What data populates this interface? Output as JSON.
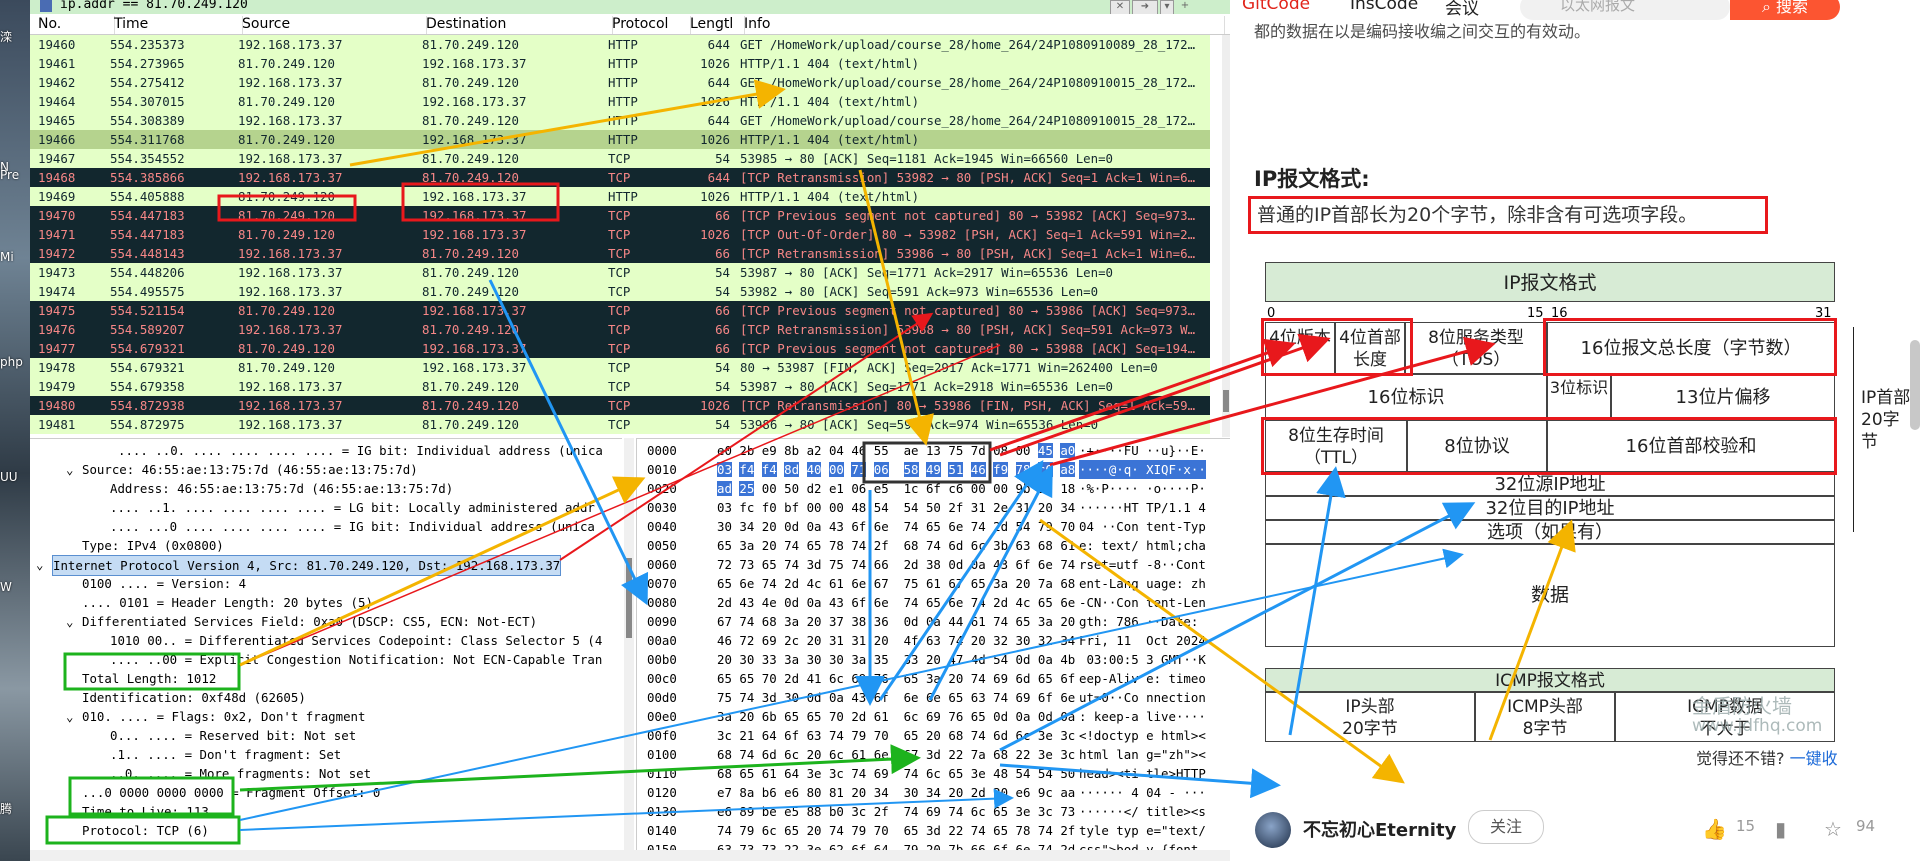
{
  "desktop": {
    "labels": [
      "滦",
      "N",
      "Pre",
      "Mi",
      "php",
      "UU",
      "W",
      "腾"
    ]
  },
  "filter": {
    "value": "ip.addr == 81.70.249.120"
  },
  "columns": [
    "No.",
    "Time",
    "Source",
    "Destination",
    "Protocol",
    "Lengtl",
    "Info"
  ],
  "packets": [
    {
      "no": "19460",
      "time": "554.235373",
      "src": "192.168.173.37",
      "dst": "81.70.249.120",
      "proto": "HTTP",
      "len": "644",
      "info": "GET /HomeWork/upload/course_28/home_264/24P1080910089_28_172…",
      "style": "g"
    },
    {
      "no": "19461",
      "time": "554.273965",
      "src": "81.70.249.120",
      "dst": "192.168.173.37",
      "proto": "HTTP",
      "len": "1026",
      "info": "HTTP/1.1 404   (text/html)",
      "style": "g"
    },
    {
      "no": "19462",
      "time": "554.275412",
      "src": "192.168.173.37",
      "dst": "81.70.249.120",
      "proto": "HTTP",
      "len": "644",
      "info": "GET /HomeWork/upload/course_28/home_264/24P1080910015_28_172…",
      "style": "g"
    },
    {
      "no": "19464",
      "time": "554.307015",
      "src": "81.70.249.120",
      "dst": "192.168.173.37",
      "proto": "HTTP",
      "len": "1026",
      "info": "HTTP/1.1 404   (text/html)",
      "style": "g"
    },
    {
      "no": "19465",
      "time": "554.308389",
      "src": "192.168.173.37",
      "dst": "81.70.249.120",
      "proto": "HTTP",
      "len": "644",
      "info": "GET /HomeWork/upload/course_28/home_264/24P1080910015_28_172…",
      "style": "g"
    },
    {
      "no": "19466",
      "time": "554.311768",
      "src": "81.70.249.120",
      "dst": "192.168.173.37",
      "proto": "HTTP",
      "len": "1026",
      "info": "HTTP/1.1 404   (text/html)",
      "style": "s"
    },
    {
      "no": "19467",
      "time": "554.354552",
      "src": "192.168.173.37",
      "dst": "81.70.249.120",
      "proto": "TCP",
      "len": "54",
      "info": "53985 → 80 [ACK] Seq=1181 Ack=1945 Win=66560 Len=0",
      "style": "g"
    },
    {
      "no": "19468",
      "time": "554.385866",
      "src": "192.168.173.37",
      "dst": "81.70.249.120",
      "proto": "TCP",
      "len": "644",
      "info": "[TCP Retransmission] 53982 → 80 [PSH, ACK] Seq=1 Ack=1 Win=6…",
      "style": "d"
    },
    {
      "no": "19469",
      "time": "554.405888",
      "src": "81.70.249.120",
      "dst": "192.168.173.37",
      "proto": "HTTP",
      "len": "1026",
      "info": "HTTP/1.1 404   (text/html)",
      "style": "g"
    },
    {
      "no": "19470",
      "time": "554.447183",
      "src": "81.70.249.120",
      "dst": "192.168.173.37",
      "proto": "TCP",
      "len": "66",
      "info": "[TCP Previous segment not captured] 80 → 53982 [ACK] Seq=973…",
      "style": "d"
    },
    {
      "no": "19471",
      "time": "554.447183",
      "src": "81.70.249.120",
      "dst": "192.168.173.37",
      "proto": "TCP",
      "len": "1026",
      "info": "[TCP Out-Of-Order] 80 → 53982 [PSH, ACK] Seq=1 Ack=591 Win=2…",
      "style": "d"
    },
    {
      "no": "19472",
      "time": "554.448143",
      "src": "192.168.173.37",
      "dst": "81.70.249.120",
      "proto": "TCP",
      "len": "66",
      "info": "[TCP Retransmission] 53986 → 80 [PSH, ACK] Seq=1 Ack=1 Win=6…",
      "style": "d"
    },
    {
      "no": "19473",
      "time": "554.448206",
      "src": "192.168.173.37",
      "dst": "81.70.249.120",
      "proto": "TCP",
      "len": "54",
      "info": "53987 → 80 [ACK] Seq=1771 Ack=2917 Win=65536 Len=0",
      "style": "g"
    },
    {
      "no": "19474",
      "time": "554.495575",
      "src": "192.168.173.37",
      "dst": "81.70.249.120",
      "proto": "TCP",
      "len": "54",
      "info": "53982 → 80 [ACK] Seq=591 Ack=973 Win=65536 Len=0",
      "style": "g"
    },
    {
      "no": "19475",
      "time": "554.521154",
      "src": "81.70.249.120",
      "dst": "192.168.173.37",
      "proto": "TCP",
      "len": "66",
      "info": "[TCP Previous segment not captured] 80 → 53986 [ACK] Seq=973…",
      "style": "d"
    },
    {
      "no": "19476",
      "time": "554.589207",
      "src": "192.168.173.37",
      "dst": "81.70.249.120",
      "proto": "TCP",
      "len": "66",
      "info": "[TCP Retransmission] 53988 → 80 [PSH, ACK] Seq=591 Ack=973 W…",
      "style": "d"
    },
    {
      "no": "19477",
      "time": "554.679321",
      "src": "81.70.249.120",
      "dst": "192.168.173.37",
      "proto": "TCP",
      "len": "66",
      "info": "[TCP Previous segment not captured] 80 → 53988 [ACK] Seq=194…",
      "style": "d"
    },
    {
      "no": "19478",
      "time": "554.679321",
      "src": "81.70.249.120",
      "dst": "192.168.173.37",
      "proto": "TCP",
      "len": "54",
      "info": "80 → 53987 [FIN, ACK] Seq=2917 Ack=1771 Win=262400 Len=0",
      "style": "g"
    },
    {
      "no": "19479",
      "time": "554.679358",
      "src": "192.168.173.37",
      "dst": "81.70.249.120",
      "proto": "TCP",
      "len": "54",
      "info": "53987 → 80 [ACK] Seq=1771 Ack=2918 Win=65536 Len=0",
      "style": "g"
    },
    {
      "no": "19480",
      "time": "554.872938",
      "src": "192.168.173.37",
      "dst": "81.70.249.120",
      "proto": "TCP",
      "len": "1026",
      "info": "[TCP Retransmission] 80 → 53986 [FIN, PSH, ACK] Seq=1 Ack=59…",
      "style": "d"
    },
    {
      "no": "19481",
      "time": "554.872975",
      "src": "192.168.173.37",
      "dst": "81.70.249.120",
      "proto": "TCP",
      "len": "54",
      "info": "53986 → 80 [ACK] Seq=591 Ack=974 Win=65536 Len=0",
      "style": "g"
    }
  ],
  "details": [
    {
      "t": ".... ..0. .... .... .... .... = IG bit: Individual address (unica",
      "x": 88,
      "sel": false
    },
    {
      "t": "Source: 46:55:ae:13:75:7d (46:55:ae:13:75:7d)",
      "x": 52,
      "tog": "⌄",
      "sel": false
    },
    {
      "t": "Address: 46:55:ae:13:75:7d (46:55:ae:13:75:7d)",
      "x": 80,
      "sel": false
    },
    {
      "t": ".... ..1. .... .... .... .... = LG bit: Locally administered addr",
      "x": 80,
      "sel": false
    },
    {
      "t": ".... ...0 .... .... .... .... = IG bit: Individual address (unica",
      "x": 80,
      "sel": false
    },
    {
      "t": "Type: IPv4 (0x0800)",
      "x": 52,
      "sel": false
    },
    {
      "t": "Internet Protocol Version 4, Src: 81.70.249.120, Dst: 192.168.173.37",
      "x": 22,
      "tog": "⌄",
      "sel": true
    },
    {
      "t": "0100 .... = Version: 4",
      "x": 52,
      "sel": false
    },
    {
      "t": ".... 0101 = Header Length: 20 bytes (5)",
      "x": 52,
      "sel": false
    },
    {
      "t": "Differentiated Services Field: 0xa0 (DSCP: CS5, ECN: Not-ECT)",
      "x": 52,
      "tog": "⌄",
      "sel": false
    },
    {
      "t": "1010 00.. = Differentiated Services Codepoint: Class Selector 5 (4",
      "x": 80,
      "sel": false
    },
    {
      "t": ".... ..00 = Explicit Congestion Notification: Not ECN-Capable Tran",
      "x": 80,
      "sel": false
    },
    {
      "t": "Total Length: 1012",
      "x": 52,
      "sel": false
    },
    {
      "t": "Identification: 0xf48d (62605)",
      "x": 52,
      "sel": false
    },
    {
      "t": "010. .... = Flags: 0x2, Don't fragment",
      "x": 52,
      "tog": "⌄",
      "sel": false
    },
    {
      "t": "0... .... = Reserved bit: Not set",
      "x": 80,
      "sel": false
    },
    {
      "t": ".1.. .... = Don't fragment: Set",
      "x": 80,
      "sel": false
    },
    {
      "t": "..0. .... = More fragments: Not set",
      "x": 80,
      "sel": false
    },
    {
      "t": "...0 0000 0000 0000 = Fragment Offset: 0",
      "x": 52,
      "sel": false
    },
    {
      "t": "Time to Live: 113",
      "x": 52,
      "sel": false
    },
    {
      "t": "Protocol: TCP (6)",
      "x": 52,
      "sel": false
    }
  ],
  "hex": [
    {
      "off": "0000",
      "bytes": "e0 2b e9 8b a2 04 46 55  ae 13 75 7d 08 00 45 a0",
      "asc": "·+····FU ··u}··E·",
      "hl": [
        14,
        15
      ]
    },
    {
      "off": "0010",
      "bytes": "03 f4 f4 8d 40 00 71 06  58 49 51 46 f9 78 c0 a8",
      "asc": "····@·q· XIQF·x··",
      "hl": [
        0,
        1,
        2,
        3,
        4,
        5,
        6,
        7,
        8,
        9,
        10,
        11,
        12,
        13,
        14,
        15
      ]
    },
    {
      "off": "0020",
      "bytes": "ad 25 00 50 d2 e1 06 e5  1c 6f c6 00 00 9b 50 18",
      "asc": "·%·P···· ·o····P·",
      "hl": [
        0,
        1
      ]
    },
    {
      "off": "0030",
      "bytes": "03 fc f0 bf 00 00 48 54  54 50 2f 31 2e 31 20 34",
      "asc": "······HT TP/1.1 4",
      "hl": []
    },
    {
      "off": "0040",
      "bytes": "30 34 20 0d 0a 43 6f 6e  74 65 6e 74 2d 54 79 70",
      "asc": "04 ··Con tent-Typ",
      "hl": []
    },
    {
      "off": "0050",
      "bytes": "65 3a 20 74 65 78 74 2f  68 74 6d 6c 3b 63 68 61",
      "asc": "e: text/ html;cha",
      "hl": []
    },
    {
      "off": "0060",
      "bytes": "72 73 65 74 3d 75 74 66  2d 38 0d 0a 43 6f 6e 74",
      "asc": "rset=utf -8··Cont",
      "hl": []
    },
    {
      "off": "0070",
      "bytes": "65 6e 74 2d 4c 61 6e 67  75 61 67 65 3a 20 7a 68",
      "asc": "ent-Lang uage: zh",
      "hl": []
    },
    {
      "off": "0080",
      "bytes": "2d 43 4e 0d 0a 43 6f 6e  74 65 6e 74 2d 4c 65 6e",
      "asc": "-CN··Con tent-Len",
      "hl": []
    },
    {
      "off": "0090",
      "bytes": "67 74 68 3a 20 37 38 36  0d 0a 44 61 74 65 3a 20",
      "asc": "gth: 786 ··Date: ",
      "hl": []
    },
    {
      "off": "00a0",
      "bytes": "46 72 69 2c 20 31 31 20  4f 63 74 20 32 30 32 34",
      "asc": "Fri, 11  Oct 2024",
      "hl": []
    },
    {
      "off": "00b0",
      "bytes": "20 30 33 3a 30 30 3a 35  33 20 47 4d 54 0d 0a 4b",
      "asc": " 03:00:5 3 GMT··K",
      "hl": []
    },
    {
      "off": "00c0",
      "bytes": "65 65 70 2d 41 6c 69 76  65 3a 20 74 69 6d 65 6f",
      "asc": "eep-Aliv e: timeo",
      "hl": []
    },
    {
      "off": "00d0",
      "bytes": "75 74 3d 30 0d 0a 43 6f  6e 6e 65 63 74 69 6f 6e",
      "asc": "ut=0··Co nnection",
      "hl": []
    },
    {
      "off": "00e0",
      "bytes": "3a 20 6b 65 65 70 2d 61  6c 69 76 65 0d 0a 0d 0a",
      "asc": ": keep-a live····",
      "hl": []
    },
    {
      "off": "00f0",
      "bytes": "3c 21 64 6f 63 74 79 70  65 20 68 74 6d 6c 3e 3c",
      "asc": "<!doctyp e html><",
      "hl": []
    },
    {
      "off": "0100",
      "bytes": "68 74 6d 6c 20 6c 61 6e  67 3d 22 7a 68 22 3e 3c",
      "asc": "html lan g=\"zh\"><",
      "hl": []
    },
    {
      "off": "0110",
      "bytes": "68 65 61 64 3e 3c 74 69  74 6c 65 3e 48 54 54 50",
      "asc": "head><ti tle>HTTP",
      "hl": []
    },
    {
      "off": "0120",
      "bytes": "e7 8a b6 e6 80 81 20 34  30 34 20 2d 20 e6 9c aa",
      "asc": "······ 4 04 - ···",
      "hl": []
    },
    {
      "off": "0130",
      "bytes": "e6 89 be e5 88 b0 3c 2f  74 69 74 6c 65 3e 3c 73",
      "asc": "······</ title><s",
      "hl": []
    },
    {
      "off": "0140",
      "bytes": "74 79 6c 65 20 74 79 70  65 3d 22 74 65 78 74 2f",
      "asc": "tyle typ e=\"text/",
      "hl": []
    },
    {
      "off": "0150",
      "bytes": "63 73 73 22 3e 62 6f 64  79 20 7b 66 6f 6e 74 2d",
      "asc": "css\">bod y {font-",
      "hl": []
    },
    {
      "off": "0160",
      "bytes": "66 61 6d 69 6c 79 3a 54  61 68 6f 6d 61 2c 41 72",
      "asc": "family:T ahoma,Ar",
      "hl": []
    },
    {
      "off": "0170",
      "bytes": "69 61 6c 2c 73 61 6e 73  2d 73 65 72 69 66 3b 7d",
      "asc": "ial,sans -serif;}",
      "hl": []
    }
  ],
  "blog": {
    "nav": [
      "GitCode",
      "InsCode",
      "会议"
    ],
    "search_placeholder": "以太网报文",
    "search_button": "搜索",
    "top_line": "都的数据在以是编码接收编之间交互的有效动。",
    "heading": "IP报文格式:",
    "highlight": "普通的IP首部长为20个字节，除非含有可选项字段。",
    "ip_figure": {
      "title": "IP报文格式",
      "bit_0": "0",
      "bit_15": "15",
      "bit_16": "16",
      "bit_31": "31",
      "version": "4位版本",
      "hlen": "4位首部长度",
      "tos": "8位服务类型（TOS）",
      "total_len": "16位报文总长度（字节数）",
      "ident": "16位标识",
      "flags": "3位标识",
      "frag": "13位片偏移",
      "ttl": "8位生存时间（TTL）",
      "proto": "8位协议",
      "checksum": "16位首部校验和",
      "src": "32位源IP地址",
      "dst": "32位目的IP地址",
      "options": "选项（如果有）",
      "data": "数据",
      "side_label": "IP首部20字节"
    },
    "icmp_figure": {
      "title": "ICMP报文格式",
      "ip_header": "IP头部",
      "ip_header_size": "20字节",
      "icmp_header": "ICMP头部",
      "icmp_header_size": "8字节",
      "icmp_data": "ICMP数据",
      "icmp_data_size": "不大于"
    },
    "watermark_1": "金盾防火墙",
    "watermark_2": "www.jdfhq.com",
    "prompt": "觉得还不错?",
    "prompt_link": "一键收",
    "author": "不忘初心Eternity",
    "follow": "关注",
    "likes": "15",
    "favorites": "94"
  }
}
